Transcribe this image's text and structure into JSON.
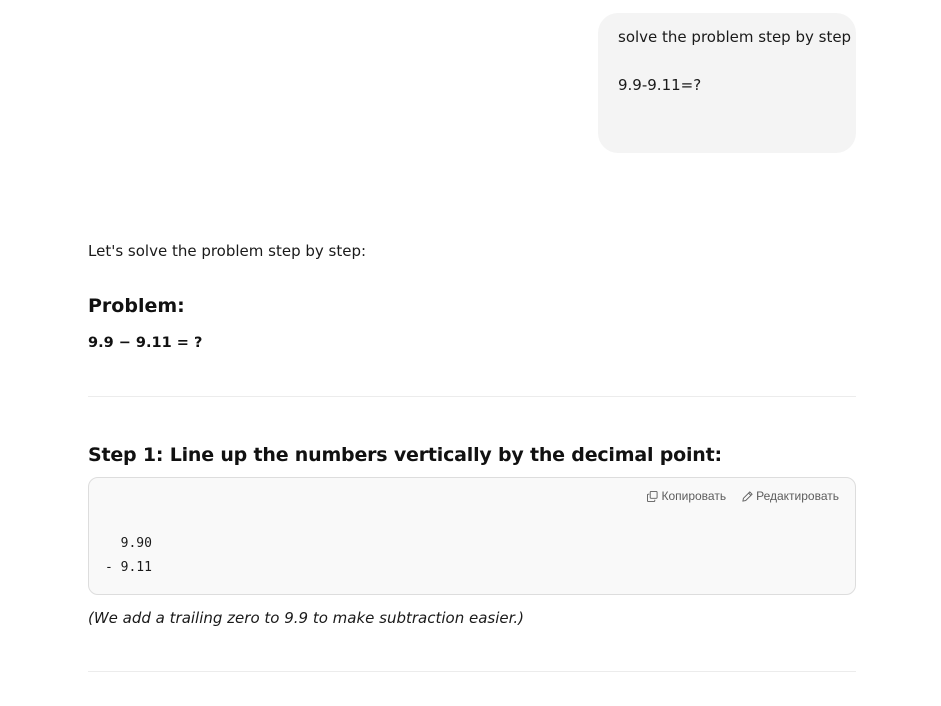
{
  "user_message": {
    "line1": "solve the problem step by step",
    "line2": "9.9-9.11=?"
  },
  "assistant": {
    "intro": "Let's solve the problem step by step:",
    "problem_heading": "Problem:",
    "problem_expression": "9.9 − 9.11 = ?",
    "step1_heading": "Step 1: Line up the numbers vertically by the decimal point:",
    "code_block": {
      "copy_label": "Копировать",
      "edit_label": "Редактировать",
      "copy_icon": "copy-icon",
      "edit_icon": "pencil-icon",
      "line1": "  9.90",
      "line2": "- 9.11"
    },
    "step1_note": "(We add a trailing zero to 9.9 to make subtraction easier.)"
  }
}
